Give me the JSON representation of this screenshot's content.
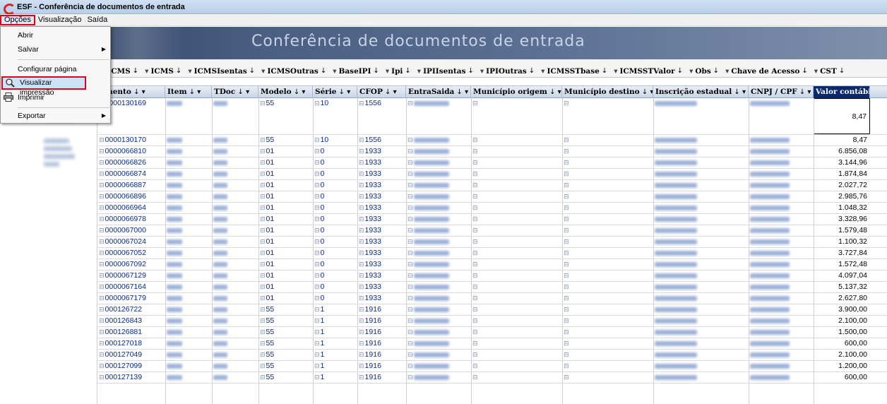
{
  "window": {
    "title": "ESF - Conferência de documentos de entrada"
  },
  "menubar": {
    "items": [
      "Opções",
      "Visualização",
      "Saída"
    ]
  },
  "dropdown": {
    "items": [
      {
        "label": "Abrir",
        "submenu": false
      },
      {
        "label": "Salvar",
        "submenu": true
      },
      {
        "label": "Configurar página",
        "submenu": false
      },
      {
        "label": "Visualizar impressão",
        "submenu": false
      },
      {
        "label": "Imprimir",
        "submenu": false
      },
      {
        "label": "Exportar",
        "submenu": true
      }
    ]
  },
  "banner": {
    "title": "Conferência de documentos de entrada"
  },
  "group_columns": [
    "ICMS",
    "ICMS",
    "ICMSIsentas",
    "ICMSOutras",
    "BaseIPI",
    "Ipi",
    "IPIIsentas",
    "IPIOutras",
    "ICMSSTbase",
    "ICMSSTValor",
    "Obs",
    "Chave de Acesso",
    "CST"
  ],
  "columns": [
    "umento",
    "Item",
    "TDoc",
    "Modelo",
    "Série",
    "CFOP",
    "EntraSaida",
    "Município origem",
    "Município destino",
    "Inscrição estadual",
    "CNPJ / CPF",
    "Valor contábil"
  ],
  "rows": [
    {
      "doc": "0000130169",
      "modelo": "55",
      "serie": "10",
      "cfop": "1556",
      "valor": "8,47"
    },
    {
      "doc": "0000130170",
      "modelo": "55",
      "serie": "10",
      "cfop": "1556",
      "valor": "8,47"
    },
    {
      "doc": "0000066810",
      "modelo": "01",
      "serie": "0",
      "cfop": "1933",
      "valor": "6.856,08"
    },
    {
      "doc": "0000066826",
      "modelo": "01",
      "serie": "0",
      "cfop": "1933",
      "valor": "3.144,96"
    },
    {
      "doc": "0000066874",
      "modelo": "01",
      "serie": "0",
      "cfop": "1933",
      "valor": "1.874,84"
    },
    {
      "doc": "0000066887",
      "modelo": "01",
      "serie": "0",
      "cfop": "1933",
      "valor": "2.027,72"
    },
    {
      "doc": "0000066896",
      "modelo": "01",
      "serie": "0",
      "cfop": "1933",
      "valor": "2.985,76"
    },
    {
      "doc": "0000066964",
      "modelo": "01",
      "serie": "0",
      "cfop": "1933",
      "valor": "1.048,32"
    },
    {
      "doc": "0000066978",
      "modelo": "01",
      "serie": "0",
      "cfop": "1933",
      "valor": "3.328,96"
    },
    {
      "doc": "0000067000",
      "modelo": "01",
      "serie": "0",
      "cfop": "1933",
      "valor": "1.579,48"
    },
    {
      "doc": "0000067024",
      "modelo": "01",
      "serie": "0",
      "cfop": "1933",
      "valor": "1.100,32"
    },
    {
      "doc": "0000067052",
      "modelo": "01",
      "serie": "0",
      "cfop": "1933",
      "valor": "3.727,84"
    },
    {
      "doc": "0000067092",
      "modelo": "01",
      "serie": "0",
      "cfop": "1933",
      "valor": "1.572,48"
    },
    {
      "doc": "0000067129",
      "modelo": "01",
      "serie": "0",
      "cfop": "1933",
      "valor": "4.097,04"
    },
    {
      "doc": "0000067164",
      "modelo": "01",
      "serie": "0",
      "cfop": "1933",
      "valor": "5.137,32"
    },
    {
      "doc": "0000067179",
      "modelo": "01",
      "serie": "0",
      "cfop": "1933",
      "valor": "2.627,80"
    },
    {
      "doc": "000126722",
      "modelo": "55",
      "serie": "1",
      "cfop": "1916",
      "valor": "3.900,00"
    },
    {
      "doc": "000126843",
      "modelo": "55",
      "serie": "1",
      "cfop": "1916",
      "valor": "2.100,00"
    },
    {
      "doc": "000126881",
      "modelo": "55",
      "serie": "1",
      "cfop": "1916",
      "valor": "1.500,00"
    },
    {
      "doc": "000127018",
      "modelo": "55",
      "serie": "1",
      "cfop": "1916",
      "valor": "600,00"
    },
    {
      "doc": "000127049",
      "modelo": "55",
      "serie": "1",
      "cfop": "1916",
      "valor": "2.100,00"
    },
    {
      "doc": "000127099",
      "modelo": "55",
      "serie": "1",
      "cfop": "1916",
      "valor": "1.200,00"
    },
    {
      "doc": "000127139",
      "modelo": "55",
      "serie": "1",
      "cfop": "1916",
      "valor": "600,00"
    }
  ],
  "theme": {
    "highlight_border": "#e0001b",
    "header_dark": "#0a2a6e",
    "cell_text": "#0a2a8a"
  }
}
